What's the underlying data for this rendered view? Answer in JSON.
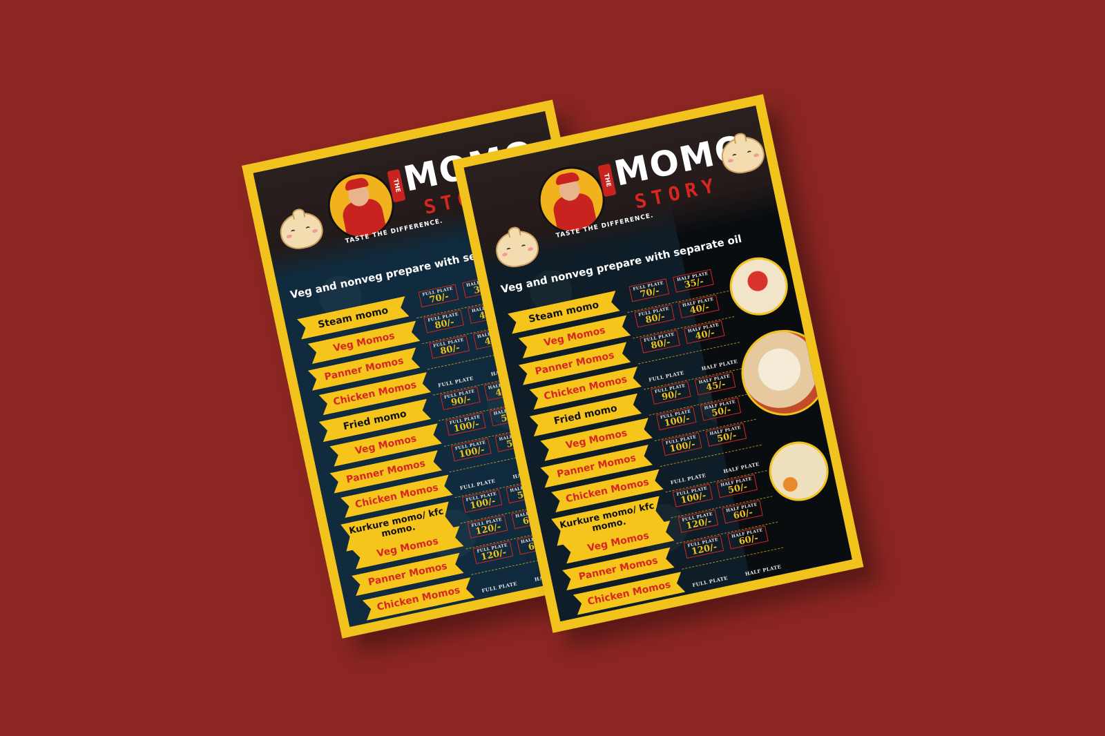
{
  "brand": {
    "the": "THE",
    "name": "MOMO",
    "subtitle": "STORY",
    "tagline": "TASTE THE DIFFERENCE."
  },
  "headline": "Veg and nonveg prepare with separate oil",
  "labels": {
    "full": "FULL PLATE",
    "half": "HALF PLATE"
  },
  "menu": [
    {
      "name": "Steam momo",
      "color": "black",
      "full": "70/-",
      "half": "35/-"
    },
    {
      "name": "Veg Momos",
      "color": "red",
      "full": "80/-",
      "half": "40/-"
    },
    {
      "name": "Panner Momos",
      "color": "red",
      "full": "80/-",
      "half": "40/-"
    },
    {
      "name": "Chicken Momos",
      "color": "red",
      "full": "",
      "half": ""
    },
    {
      "name": "Fried momo",
      "color": "black",
      "full": "90/-",
      "half": "45/-"
    },
    {
      "name": "Veg Momos",
      "color": "red",
      "full": "100/-",
      "half": "50/-"
    },
    {
      "name": "Panner Momos",
      "color": "red",
      "full": "100/-",
      "half": "50/-"
    },
    {
      "name": "Chicken Momos",
      "color": "red",
      "full": "",
      "half": ""
    },
    {
      "name": "Kurkure momo/ kfc momo.",
      "color": "black",
      "full": "100/-",
      "half": "50/-"
    },
    {
      "name": "Veg Momos",
      "color": "red",
      "full": "120/-",
      "half": "60/-"
    },
    {
      "name": "Panner Momos",
      "color": "red",
      "full": "120/-",
      "half": "60/-"
    },
    {
      "name": "Chicken Momos",
      "color": "red",
      "full": "",
      "half": ""
    }
  ],
  "colors": {
    "background": "#8b2622",
    "border": "#f2c31d",
    "accent_red": "#d7261f",
    "panel": "#0f2b3d"
  }
}
